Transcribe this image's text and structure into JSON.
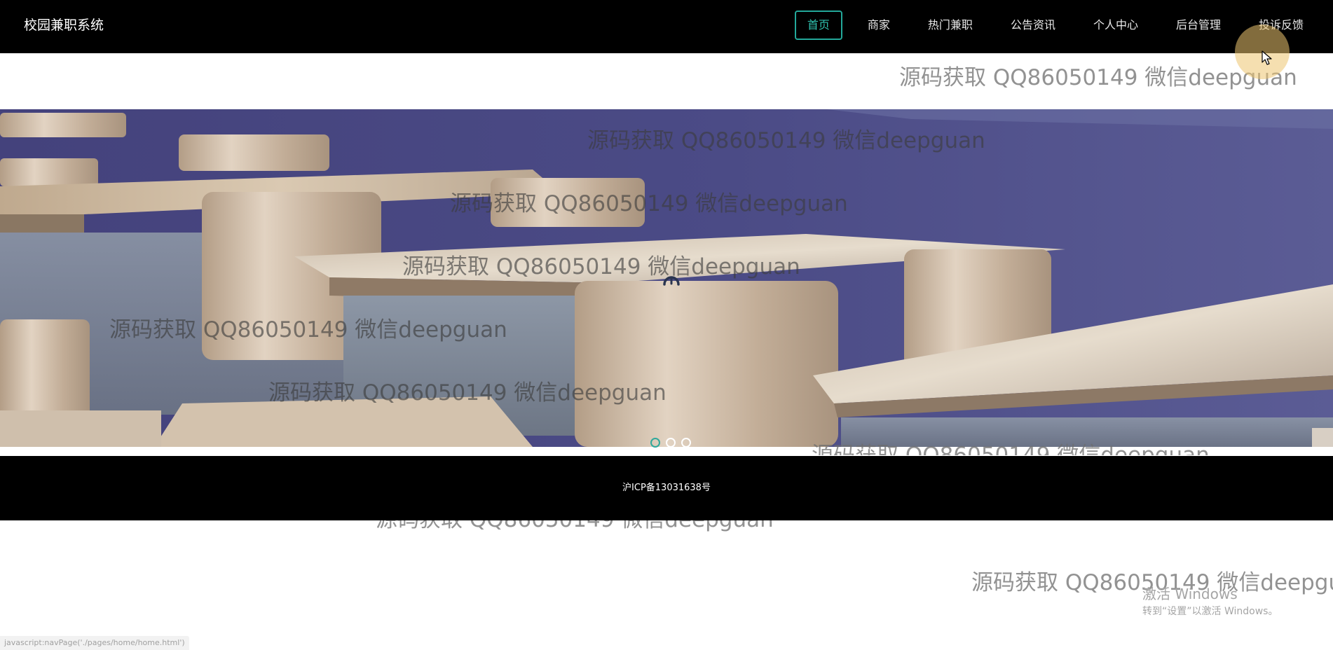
{
  "app": {
    "brand": "校园兼职系统"
  },
  "nav": {
    "items": [
      {
        "label": "首页",
        "active": true
      },
      {
        "label": "商家"
      },
      {
        "label": "热门兼职"
      },
      {
        "label": "公告资讯"
      },
      {
        "label": "个人中心"
      },
      {
        "label": "后台管理"
      },
      {
        "label": "投诉反馈"
      }
    ],
    "active_color": "#2fc2b0"
  },
  "banner": {
    "slide_count": 3,
    "active_slide": 1
  },
  "footer": {
    "icp": "沪ICP备13031638号"
  },
  "watermark": {
    "text": "源码获取 QQ86050149 微信deepguan",
    "text_cut": "源码获取 QQ86050149 微信deepgua"
  },
  "os": {
    "activate_title": "激活 Windows",
    "activate_subtitle": "转到“设置”以激活 Windows。",
    "status_url": "javascript:navPage('./pages/home/home.html')"
  },
  "colors": {
    "topbar_bg": "#000000",
    "footer_bg": "#000000",
    "accent": "#2fc2b0"
  }
}
